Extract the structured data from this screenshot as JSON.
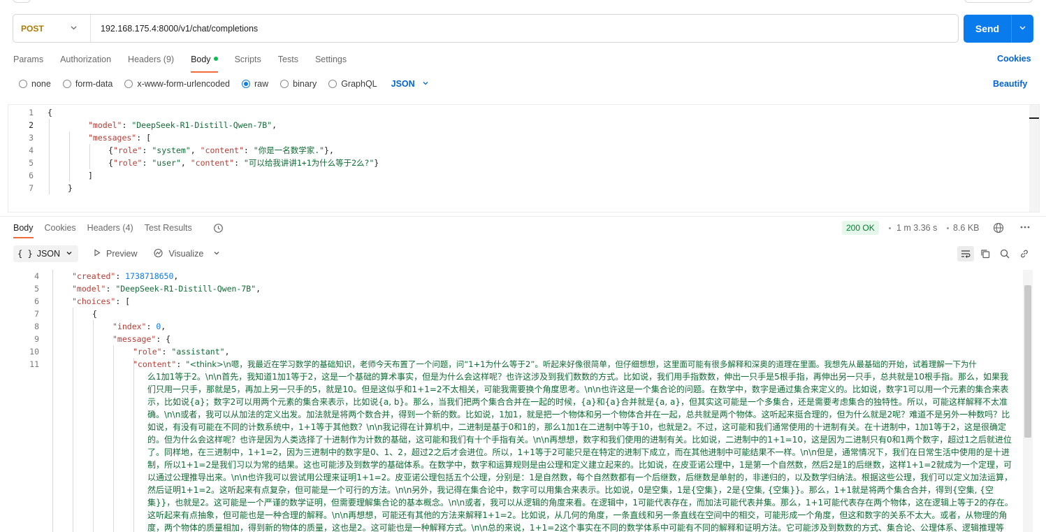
{
  "request": {
    "method": "POST",
    "url": "192.168.175.4:8000/v1/chat/completions",
    "send_label": "Send"
  },
  "request_tabs": [
    {
      "label": "Params"
    },
    {
      "label": "Authorization"
    },
    {
      "label": "Headers",
      "count": "(9)"
    },
    {
      "label": "Body"
    },
    {
      "label": "Scripts"
    },
    {
      "label": "Tests"
    },
    {
      "label": "Settings"
    }
  ],
  "cookies_label": "Cookies",
  "beautify_label": "Beautify",
  "body_types": [
    "none",
    "form-data",
    "x-www-form-urlencoded",
    "raw",
    "binary",
    "GraphQL"
  ],
  "body_lang": "JSON",
  "request_body": {
    "line_numbers": [
      "1",
      "2",
      "3",
      "4",
      "5",
      "6",
      "7"
    ],
    "open_brace": "{",
    "model_key": "\"model\"",
    "model_val": "\"DeepSeek-R1-Distill-Qwen-7B\"",
    "messages_key": "\"messages\"",
    "open_bracket": "[",
    "role_key": "\"role\"",
    "content_key": "\"content\"",
    "role_system": "\"system\"",
    "content_system": "\"你是一名数学家.\"",
    "role_user": "\"user\"",
    "content_user": "\"可以给我讲讲1+1为什么等于2么?\"",
    "close_bracket": "]",
    "close_brace": "}"
  },
  "response_tabs": [
    {
      "label": "Body"
    },
    {
      "label": "Cookies"
    },
    {
      "label": "Headers",
      "count": "(4)"
    },
    {
      "label": "Test Results"
    }
  ],
  "response_meta": {
    "status": "200 OK",
    "time": "1 m 3.36 s",
    "size": "8.6 KB"
  },
  "view": {
    "format": "JSON",
    "preview_label": "Preview",
    "visualize_label": "Visualize"
  },
  "response_body": {
    "line_numbers": [
      "4",
      "5",
      "6",
      "7",
      "8",
      "9",
      "10",
      "11"
    ],
    "created_key": "\"created\"",
    "created_val": "1738718650",
    "model_key": "\"model\"",
    "model_val": "\"DeepSeek-R1-Distill-Qwen-7B\"",
    "choices_key": "\"choices\"",
    "open_bracket": "[",
    "open_brace": "{",
    "index_key": "\"index\"",
    "index_val": "0",
    "message_key": "\"message\"",
    "role_key": "\"role\"",
    "role_val": "\"assistant\"",
    "content_key": "\"content\"",
    "content_first": "\"<think>\\n嗯，我最近在学习数学的基础知识，老师今天布置了一个问题，问“1+1为什么等于2”。听起来好像很简单，但仔细想想，这里面可能有很多解释和深奥的道理在里面。我想先从最基础的开始，试着理解一下为什",
    "content_rest": "么1加1等于2。\\n\\n首先，我知道1加1等于2，这是一个基础的算术事实，但是为什么会这样呢？也许这涉及到我们数数的方式。比如说，我们用手指数数，伸出一只手是5根手指，再伸出另一只手，总共就是10根手指。那么，如果我们只用一只手，那就是5，再加上另一只手的5，就是10。但是这似乎和1+1=2不太相关，可能我需要换个角度思考。\\n\\n也许这是一个集合论的问题。在数学中，数字是通过集合来定义的。比如说，数字1可以用一个元素的集合来表示，比如说{a}；数字2可以用两个元素的集合来表示，比如说{a, b}。那么，当我们把两个集合合并在一起的时候，{a}和{a}合并就是{a, a}，但其实这可能是一个多集合，还是需要考虑集合的独特性。所以，可能这样解释不太准确。\\n\\n或者，我可以从加法的定义出发。加法就是将两个数合并，得到一个新的数。比如说，1加1，就是把一个物体和另一个物体合并在一起，总共就是两个物体。这听起来挺合理的，但为什么就是2呢？难道不是另外一种数吗？比如说，有没有可能在不同的计数系统中，1+1等于其他数？\\n\\n我记得在计算机中，二进制是基于0和1的，那么1加1在二进制中等于10，也就是2。不过，这可能和我们通常使用的十进制有关。在十进制中，1加1等于2，这是很确定的。但为什么会这样呢？也许是因为人类选择了十进制作为计数的基础，这可能和我们有十个手指有关。\\n\\n再想想，数字和我们使用的进制有关。比如说，二进制中的1+1=10，这是因为二进制只有0和1两个数字，超过1之后就进位了。同样地，在三进制中，1+1=2，因为三进制中的数字是0、1、2，超过2之后才会进位。所以，1+1等于2可能只是在特定的进制下成立，而在其他进制中可能结果不一样。\\n\\n但是，通常情况下，我们在日常生活中使用的是十进制，所以1+1=2是我们习以为常的结果。这也可能涉及到数学的基础体系。在数学中，数字和运算规则是由公理和定义建立起来的。比如说，在皮亚诺公理中，1是第一个自然数，然后2是1的后继数，这样1+1=2就成为一个定理，可以通过公理推导出来。\\n\\n也许我可以尝试用公理来证明1+1=2。皮亚诺公理包括五个公理，分别是：1是自然数，每个自然数都有一个后继数，后继数是单射的，非递归的，以及数学归纳法。根据这些公理，我们可以定义加法运算，然后证明1+1=2。这听起来有点复杂，但可能是一个可行的方法。\\n\\n另外，我记得在集合论中，数字可以用集合来表示。比如说，0是空集，1是{空集}，2是{空集, {空集}}。那么，1+1就是将两个集合合并，得到{空集, {空集}}，也就是2。这可能是一个严谨的数学证明，但需要理解集合论的基本概念。\\n\\n或者，我可以从逻辑的角度来看。在逻辑中，1可能代表存在，而加法可能代表并集。那么，1+1可能代表存在两个物体，这在逻辑上等于2的存在。这听起来有点抽象，但可能也是一种合理的解释。\\n\\n再想想，可能还有其他的方法来解释1+1=2。比如说，从几何的角度，一条直线和另一条直线在空间中的相交，可能形成一个角度，但这和数字的关系不太大。或者，从物理的角度，两个物体的质量相加，得到新的物体的质量，这也是2。这可能也是一种解释方式。\\n\\n总的来说，1+1=2这个事实在不同的数学体系中可能有不同的解释和证明方法。它可能涉及到数数的方式、集合论、公理体系、逻辑推理等等。虽然"
  }
}
